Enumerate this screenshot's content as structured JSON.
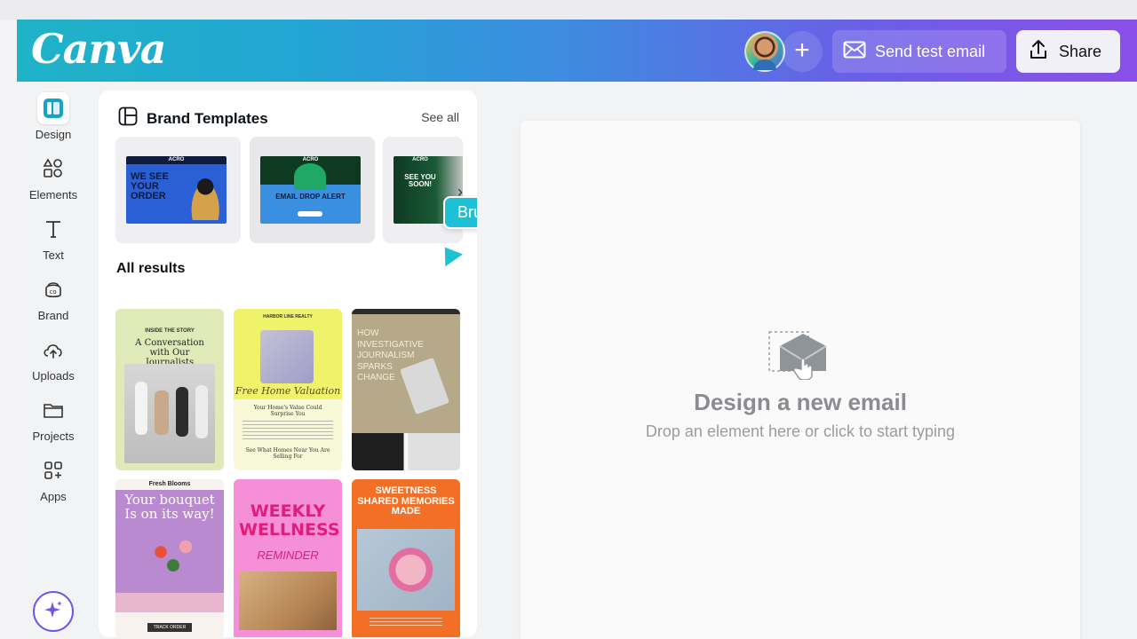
{
  "header": {
    "logo": "Canva",
    "send_test_email": "Send test email",
    "share": "Share"
  },
  "rail": {
    "items": [
      {
        "label": "Design",
        "icon": "design-icon"
      },
      {
        "label": "Elements",
        "icon": "elements-icon"
      },
      {
        "label": "Text",
        "icon": "text-icon"
      },
      {
        "label": "Brand",
        "icon": "brand-icon"
      },
      {
        "label": "Uploads",
        "icon": "uploads-icon"
      },
      {
        "label": "Projects",
        "icon": "projects-icon"
      },
      {
        "label": "Apps",
        "icon": "apps-icon"
      }
    ]
  },
  "panel": {
    "brand_templates_title": "Brand Templates",
    "see_all": "See all",
    "collaborator": "Bruno",
    "templates": [
      {
        "brand": "ACRO",
        "headline": "WE SEE YOUR ORDER"
      },
      {
        "brand": "ACRO",
        "headline": "EMAIL DROP ALERT"
      },
      {
        "brand": "ACRO",
        "headline": "SEE YOU SOON!"
      }
    ],
    "all_results_title": "All results",
    "results": [
      {
        "kicker": "INSIDE THE STORY",
        "title": "A Conversation with Our Journalists"
      },
      {
        "kicker": "HARBOR LINE REALTY",
        "title": "Free Home Valuation",
        "sub1": "Your Home's Value Could Surprise You",
        "sub2": "See What Homes Near You Are Selling For"
      },
      {
        "title": "HOW INVESTIGATIVE JOURNALISM SPARKS CHANGE"
      },
      {
        "kicker": "Fresh Blooms",
        "title": "Your bouquet Is on its way!",
        "cta": "TRACK ORDER"
      },
      {
        "title": "WEEKLY WELLNESS",
        "subtitle": "REMINDER"
      },
      {
        "title": "SWEETNESS SHARED MEMORIES MADE"
      }
    ]
  },
  "canvas": {
    "title": "Design a new email",
    "subtitle": "Drop an element here or click to start typing"
  }
}
